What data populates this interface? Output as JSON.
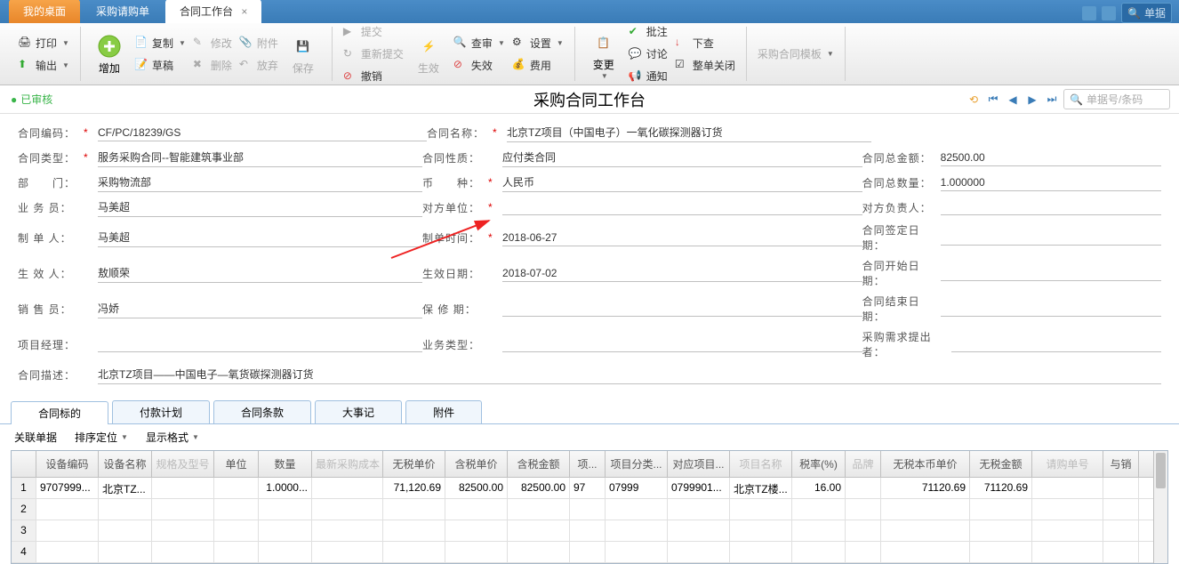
{
  "tabs": {
    "desktop": "我的桌面",
    "purchase_req": "采购请购单",
    "contract_wb": "合同工作台"
  },
  "top_search": {
    "placeholder": "单据"
  },
  "toolbar": {
    "print": "打印",
    "output": "输出",
    "add": "增加",
    "copy": "复制",
    "draft": "草稿",
    "edit": "修改",
    "delete": "删除",
    "attach": "附件",
    "abandon": "放弃",
    "save": "保存",
    "submit": "提交",
    "resubmit": "重新提交",
    "revoke": "撤销",
    "effect": "生效",
    "review": "查审",
    "invalid": "失效",
    "settings": "设置",
    "fee": "费用",
    "change": "变更",
    "approve_note": "批注",
    "discuss": "讨论",
    "notify": "通知",
    "drill": "下查",
    "full_close": "整单关闭",
    "template": "采购合同模板"
  },
  "title": {
    "status": "已审核",
    "text": "采购合同工作台",
    "search_ph": "单据号/条码"
  },
  "form": {
    "l_code": "合同编码：",
    "v_code": "CF/PC/18239/GS",
    "l_name": "合同名称：",
    "v_name": "北京TZ项目（中国电子）一氧化碳探测器订货",
    "l_type": "合同类型：",
    "v_type": "服务采购合同--智能建筑事业部",
    "l_nature": "合同性质：",
    "v_nature": "应付类合同",
    "l_total_amt": "合同总金额：",
    "v_total_amt": "82500.00",
    "l_dept": "部　　门：",
    "v_dept": "采购物流部",
    "l_currency": "币　　种：",
    "v_currency": "人民币",
    "l_total_qty": "合同总数量：",
    "v_total_qty": "1.000000",
    "l_biz": "业 务 员：",
    "v_biz": "马美超",
    "l_party": "对方单位：",
    "v_party": "",
    "l_party_owner": "对方负责人：",
    "v_party_owner": "",
    "l_maker": "制 单 人：",
    "v_maker": "马美超",
    "l_make_date": "制单时间：",
    "v_make_date": "2018-06-27",
    "l_sign_date": "合同签定日期：",
    "v_sign_date": "",
    "l_effector": "生 效 人：",
    "v_effector": "敖顺荣",
    "l_effect_date": "生效日期：",
    "v_effect_date": "2018-07-02",
    "l_start_date": "合同开始日期：",
    "v_start_date": "",
    "l_sales": "销 售 员：",
    "v_sales": "冯娇",
    "l_warranty": "保 修 期：",
    "v_warranty": "",
    "l_end_date": "合同结束日期：",
    "v_end_date": "",
    "l_pm": "项目经理：",
    "v_pm": "",
    "l_biz_type": "业务类型：",
    "v_biz_type": "",
    "l_requester": "采购需求提出者：",
    "v_requester": "",
    "l_desc": "合同描述：",
    "v_desc": "北京TZ项目——中国电子—氧货碳探测器订货"
  },
  "detail_tabs": {
    "target": "合同标的",
    "payment": "付款计划",
    "terms": "合同条款",
    "events": "大事记",
    "attach": "附件"
  },
  "grid_tb": {
    "related": "关联单据",
    "sort": "排序定位",
    "format": "显示格式"
  },
  "grid": {
    "headers": {
      "equip_code": "设备编码",
      "equip_name": "设备名称",
      "spec": "规格及型号",
      "unit": "单位",
      "qty": "数量",
      "latest_cost": "最新采购成本",
      "notax_price": "无税单价",
      "tax_price": "含税单价",
      "tax_amt": "含税金额",
      "proj": "项...",
      "proj_class": "项目分类...",
      "proj_ref": "对应项目...",
      "proj_name": "项目名称",
      "tax_rate": "税率(%)",
      "brand": "品牌",
      "notax_local": "无税本币单价",
      "notax_amt": "无税金额",
      "req_no": "请购单号",
      "linked": "与销"
    },
    "rows": [
      {
        "rn": "1",
        "equip_code": "9707999...",
        "equip_name": "北京TZ...",
        "spec": "",
        "unit": "",
        "qty": "1.0000...",
        "latest_cost": "",
        "notax_price": "71,120.69",
        "tax_price": "82500.00",
        "tax_amt": "82500.00",
        "proj": "97",
        "proj_class": "07999",
        "proj_ref": "0799901...",
        "proj_name": "北京TZ楼...",
        "tax_rate": "16.00",
        "brand": "",
        "notax_local": "71120.69",
        "notax_amt": "71120.69",
        "req_no": "",
        "linked": ""
      },
      {
        "rn": "2"
      },
      {
        "rn": "3"
      },
      {
        "rn": "4"
      }
    ]
  }
}
